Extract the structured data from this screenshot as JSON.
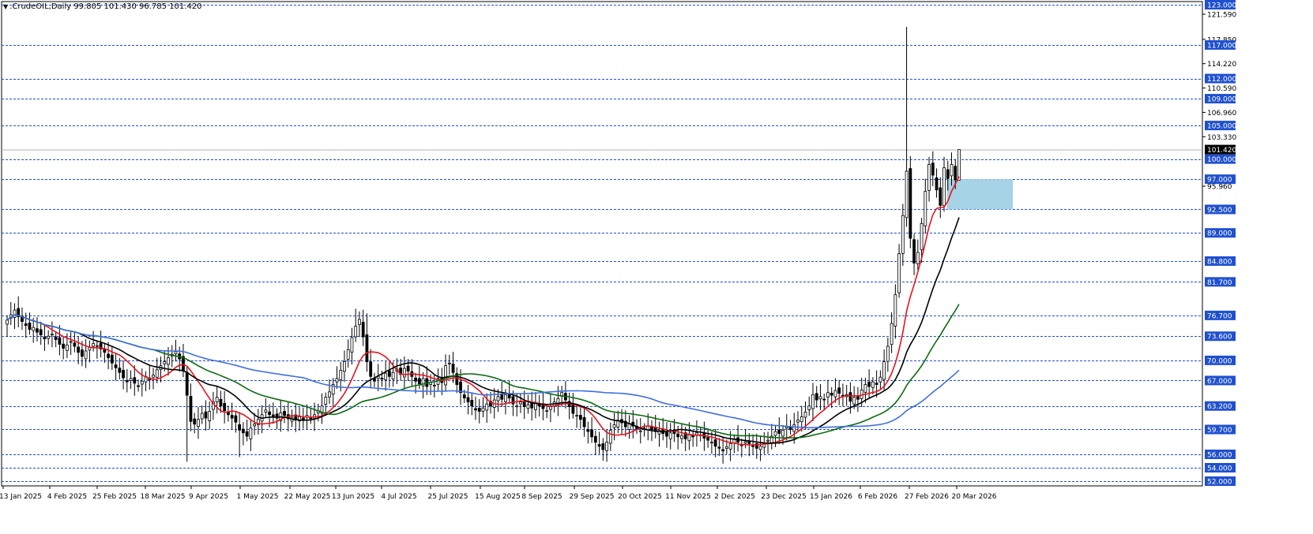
{
  "header": {
    "symbol": "CrudeOIL",
    "timeframe": "Daily",
    "text": ".CrudeOIL,Daily  99.805 101.430 96.785 101.420"
  },
  "colors": {
    "background": "#ffffff",
    "gridline": "#1f4fd6",
    "candle": "#000000",
    "ma_red": "#e8141c",
    "ma_black": "#000000",
    "ma_green": "#0b6b10",
    "ma_blue": "#3e6fe0",
    "zone_fill": "#a6d3e6",
    "level_label_bg": "#1f50cf",
    "price_label_bg": "#000000"
  },
  "chart_data": {
    "type": "candlestick",
    "instrument": "CrudeOIL",
    "timeframe": "Daily",
    "ohlc_last": {
      "open": 99.805,
      "high": 101.43,
      "low": 96.785,
      "close": 101.42
    },
    "ylim": [
      52.0,
      123.0
    ],
    "y_ticks": [
      "121.590",
      "117.850",
      "114.220",
      "110.590",
      "106.960",
      "103.330",
      "95.960"
    ],
    "x_ticks": [
      "13 Jan 2025",
      "4 Feb 2025",
      "25 Feb 2025",
      "18 Mar 2025",
      "9 Apr 2025",
      "1 May 2025",
      "22 May 2025",
      "13 Jun 2025",
      "4 Jul 2025",
      "25 Jul 2025",
      "15 Aug 2025",
      "8 Sep 2025",
      "29 Sep 2025",
      "20 Oct 2025",
      "11 Nov 2025",
      "2 Dec 2025",
      "23 Dec 2025",
      "15 Jan 2026",
      "6 Feb 2026",
      "27 Feb 2026",
      "20 Mar 2026"
    ],
    "horizontal_levels": [
      "123.000",
      "117.000",
      "112.000",
      "109.000",
      "105.000",
      "100.000",
      "97.000",
      "92.500",
      "89.000",
      "84.800",
      "81.700",
      "76.700",
      "73.600",
      "70.000",
      "67.000",
      "63.200",
      "59.700",
      "56.000",
      "54.000",
      "52.000"
    ],
    "current_price": "101.420",
    "zone": {
      "from": 92.5,
      "to": 97.0
    },
    "closes": [
      76,
      76.8,
      77.5,
      76.5,
      75.8,
      75.2,
      74.6,
      74.9,
      74.2,
      73.8,
      73.2,
      73.6,
      73.9,
      73.1,
      72.4,
      71.8,
      72.3,
      72.8,
      72.1,
      71.2,
      70.6,
      71.4,
      71.9,
      72.5,
      72.2,
      71.7,
      71.2,
      70.4,
      69.6,
      68.9,
      68.2,
      67.4,
      66.8,
      67.3,
      66.6,
      66.1,
      66.9,
      67.6,
      67.1,
      67.8,
      68.6,
      69.2,
      69.8,
      70.4,
      70.9,
      71.3,
      70.2,
      68.4,
      64.8,
      60.9,
      60.5,
      61.2,
      62.1,
      61.4,
      62.4,
      63.8,
      64.5,
      63.2,
      62.5,
      61.9,
      61.4,
      60.8,
      59.6,
      59.2,
      58.7,
      59.9,
      60.5,
      61.2,
      61.9,
      62.6,
      61.9,
      61.7,
      61.4,
      62.2,
      61.8,
      61.3,
      61.5,
      61.1,
      61.6,
      61.2,
      61.8,
      61.3,
      61.9,
      62.5,
      63.2,
      64.5,
      65.3,
      66.4,
      67.3,
      68.5,
      69.8,
      71.6,
      73.4,
      75.1,
      76.1,
      73.5,
      69.8,
      67.6,
      66.9,
      67.6,
      67.2,
      68.1,
      67.6,
      68.2,
      68.7,
      67.9,
      68.8,
      68.4,
      67.6,
      66.9,
      66.5,
      67.3,
      66.1,
      66.7,
      66.2,
      67.3,
      66.7,
      69.2,
      69.6,
      68.2,
      66.4,
      65.2,
      64.4,
      63.8,
      63.2,
      62.6,
      62.4,
      62.9,
      63.5,
      63.2,
      64.1,
      64.6,
      64.2,
      64.9,
      64.4,
      63.5,
      63.2,
      63.8,
      63.1,
      63.4,
      62.9,
      63.6,
      63.2,
      62.8,
      62.5,
      63.1,
      63.8,
      64.3,
      65.2,
      64.1,
      63.1,
      62.1,
      61.8,
      61.2,
      60.1,
      59.4,
      58.6,
      57.8,
      57.2,
      56.7,
      57.8,
      59.6,
      60.4,
      61.1,
      60.7,
      60.1,
      60.5,
      60.2,
      59.8,
      59.5,
      59.9,
      60.2,
      59.7,
      59.4,
      59.6,
      59.1,
      58.7,
      59.2,
      59.1,
      58.6,
      58.8,
      58.3,
      58.9,
      58.6,
      59.2,
      58.9,
      58.4,
      58.1,
      57.8,
      57.2,
      56.9,
      56.5,
      57.1,
      57.6,
      58.2,
      57.8,
      57.4,
      57.9,
      57.6,
      57.2,
      56.9,
      57.2,
      57.6,
      58.1,
      58.7,
      59.4,
      59.1,
      59.6,
      60.1,
      59.7,
      60.4,
      61.1,
      61.6,
      62.3,
      63.2,
      64.9,
      64.1,
      64.6,
      64.2,
      65.2,
      64.8,
      65.5,
      65.1,
      64.6,
      64.9,
      63.9,
      64.5,
      64.2,
      65.6,
      66.4,
      66.1,
      66.8,
      66.4,
      67.5,
      69.8,
      72.1,
      75.5,
      79.8,
      85.9,
      91.6,
      98.2,
      88.2,
      84.5,
      86.1,
      90.4,
      95.2,
      99.2,
      97.6,
      95.4,
      93.1,
      98.7,
      97.1,
      99.2,
      96.9,
      101.42
    ],
    "series": [
      {
        "period": 10,
        "color": "red"
      },
      {
        "period": 20,
        "color": "black"
      },
      {
        "period": 40,
        "color": "green"
      },
      {
        "period": 80,
        "color": "blue"
      }
    ]
  }
}
